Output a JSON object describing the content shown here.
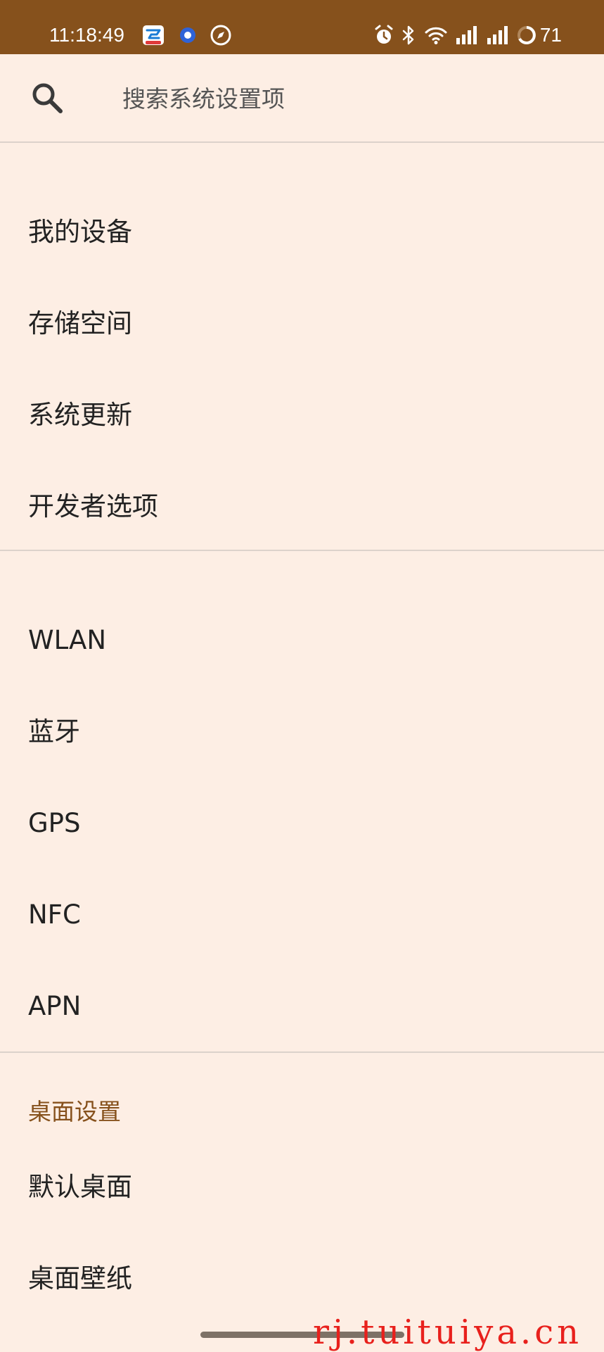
{
  "status_bar": {
    "time": "11:18:49",
    "battery_level": "71",
    "left_icons": [
      "app-notification-icon",
      "dot-notification-icon",
      "compass-notification-icon"
    ],
    "right_icons": [
      "alarm-icon",
      "bluetooth-icon",
      "wifi-icon",
      "signal-icon",
      "signal-icon",
      "battery-ring-icon"
    ]
  },
  "search": {
    "placeholder": "搜索系统设置项"
  },
  "group1": {
    "items": [
      {
        "label": "我的设备"
      },
      {
        "label": "存储空间"
      },
      {
        "label": "系统更新"
      },
      {
        "label": "开发者选项"
      }
    ]
  },
  "group2": {
    "items": [
      {
        "label": "WLAN"
      },
      {
        "label": "蓝牙"
      },
      {
        "label": "GPS"
      },
      {
        "label": "NFC"
      },
      {
        "label": "APN"
      }
    ]
  },
  "group3": {
    "header": "桌面设置",
    "items": [
      {
        "label": "默认桌面"
      },
      {
        "label": "桌面壁纸"
      }
    ]
  },
  "watermark": "rj.tuituiya.cn",
  "colors": {
    "status_bar": "#86511c",
    "background": "#fdeee4",
    "section_header": "#86511c",
    "divider": "#dcd2cb",
    "watermark": "#e8201c"
  }
}
